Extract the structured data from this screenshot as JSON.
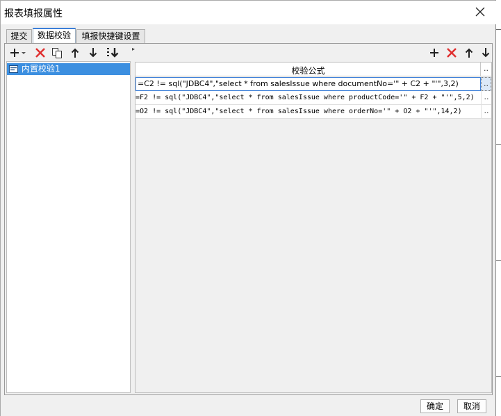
{
  "window": {
    "title": "报表填报属性"
  },
  "tabs": [
    {
      "label": "提交",
      "active": false
    },
    {
      "label": "数据校验",
      "active": true
    },
    {
      "label": "填报快捷键设置",
      "active": false
    }
  ],
  "left_toolbar": {
    "icons": [
      "add-dropdown-icon",
      "delete-icon",
      "copy-icon",
      "move-up-icon",
      "move-down-icon",
      "move-to-bottom-icon"
    ]
  },
  "left_list": {
    "items": [
      {
        "label": "内置校验1",
        "selected": true
      }
    ]
  },
  "right_toolbar": {
    "icons": [
      "add-icon",
      "delete-icon",
      "move-up-icon",
      "move-down-icon"
    ]
  },
  "grid": {
    "header": "校验公式",
    "ellipsis": "..",
    "rows": [
      {
        "formula": "=C2 != sql(\"JDBC4\",\"select * from salesIssue where documentNo='\" + C2 + \"'\",3,2)",
        "selected": true
      },
      {
        "formula": "=F2 != sql(\"JDBC4\",\"select * from salesIssue where productCode='\" + F2 + \"'\",5,2)",
        "selected": false
      },
      {
        "formula": "=O2 != sql(\"JDBC4\",\"select * from salesIssue where orderNo='\" + O2 + \"'\",14,2)",
        "selected": false
      }
    ]
  },
  "footer": {
    "ok_label": "确定",
    "cancel_label": "取消"
  },
  "colors": {
    "accent": "#3c8fe0",
    "delete_red": "#e03030",
    "tab_highlight": "#3c7fd8"
  }
}
